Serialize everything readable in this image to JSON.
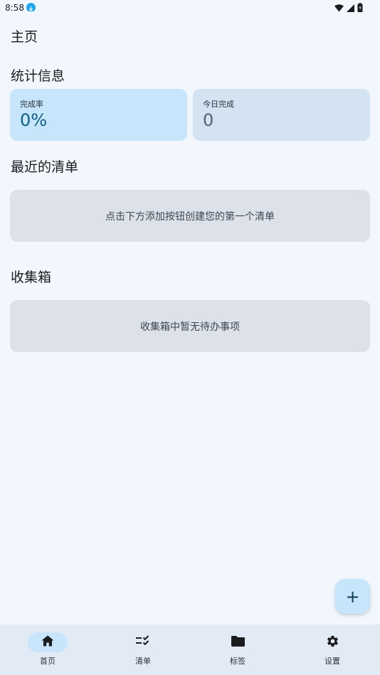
{
  "status_bar": {
    "time": "8:58"
  },
  "page": {
    "title": "主页"
  },
  "stats": {
    "title": "统计信息",
    "completion_rate": {
      "label": "完成率",
      "value": "0%"
    },
    "completed_today": {
      "label": "今日完成",
      "value": "0"
    }
  },
  "recent_lists": {
    "title": "最近的清单",
    "empty_text": "点击下方添加按钮创建您的第一个清单"
  },
  "inbox": {
    "title": "收集箱",
    "empty_text": "收集箱中暂无待办事项"
  },
  "fab": {
    "icon": "plus-icon",
    "label": "+"
  },
  "nav": {
    "items": [
      {
        "label": "首页",
        "icon": "home-icon",
        "active": true
      },
      {
        "label": "清单",
        "icon": "checklist-icon",
        "active": false
      },
      {
        "label": "标签",
        "icon": "folder-icon",
        "active": false
      },
      {
        "label": "设置",
        "icon": "gear-icon",
        "active": false
      }
    ]
  },
  "colors": {
    "background": "#f1f7fd",
    "accent_container": "#c7e6fb",
    "secondary_container": "#d4e3f1",
    "empty_card": "#dde2ea",
    "nav_background": "#e2ebf5",
    "download_badge": "#1ea7f0"
  }
}
